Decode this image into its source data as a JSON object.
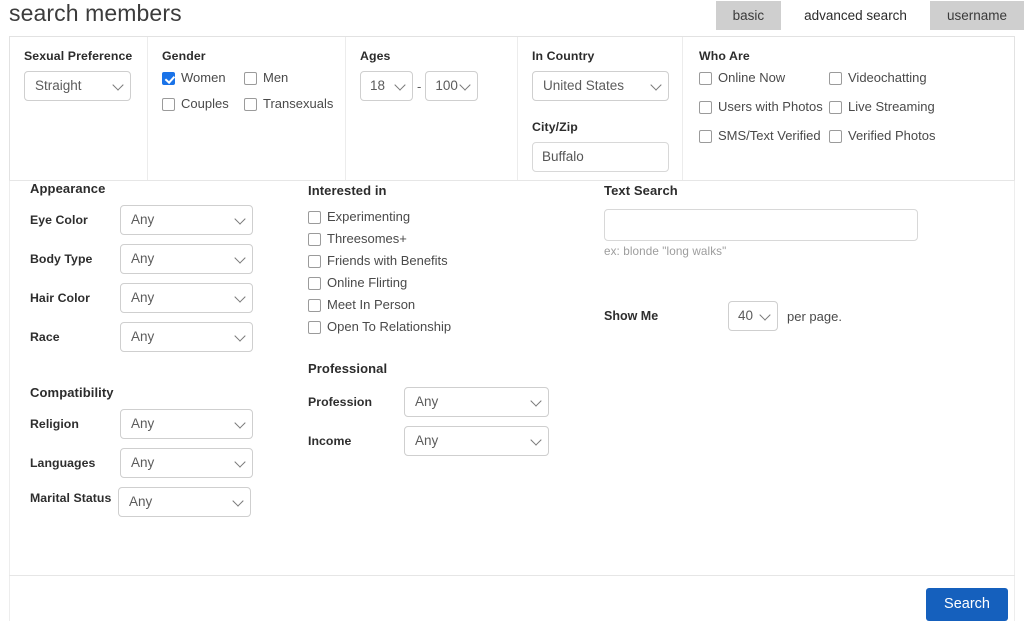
{
  "header": {
    "title": "search members",
    "tabs": [
      {
        "label": "basic",
        "active": false
      },
      {
        "label": "advanced search",
        "active": true
      },
      {
        "label": "username",
        "active": false
      }
    ]
  },
  "top_panel": {
    "sexual_preference": {
      "label": "Sexual Preference",
      "value": "Straight"
    },
    "gender": {
      "label": "Gender",
      "options": [
        {
          "label": "Women",
          "checked": true
        },
        {
          "label": "Men",
          "checked": false
        },
        {
          "label": "Couples",
          "checked": false
        },
        {
          "label": "Transexuals",
          "checked": false
        }
      ]
    },
    "ages": {
      "label": "Ages",
      "min": "18",
      "separator": "-",
      "max": "100"
    },
    "country": {
      "label": "In Country",
      "value": "United States"
    },
    "city_zip": {
      "label": "City/Zip",
      "value": "Buffalo"
    },
    "who_are": {
      "label": "Who Are",
      "options": [
        {
          "label": "Online Now",
          "checked": false
        },
        {
          "label": "Videochatting",
          "checked": false
        },
        {
          "label": "Users with Photos",
          "checked": false
        },
        {
          "label": "Live Streaming",
          "checked": false
        },
        {
          "label": "SMS/Text Verified",
          "checked": false
        },
        {
          "label": "Verified Photos",
          "checked": false
        }
      ]
    }
  },
  "appearance": {
    "title": "Appearance",
    "fields": [
      {
        "label": "Eye Color",
        "value": "Any"
      },
      {
        "label": "Body Type",
        "value": "Any"
      },
      {
        "label": "Hair Color",
        "value": "Any"
      },
      {
        "label": "Race",
        "value": "Any"
      }
    ]
  },
  "compatibility": {
    "title": "Compatibility",
    "fields": [
      {
        "label": "Religion",
        "value": "Any"
      },
      {
        "label": "Languages",
        "value": "Any"
      },
      {
        "label": "Marital Status",
        "value": "Any"
      }
    ]
  },
  "interested_in": {
    "title": "Interested in",
    "options": [
      {
        "label": "Experimenting",
        "checked": false
      },
      {
        "label": "Threesomes+",
        "checked": false
      },
      {
        "label": "Friends with Benefits",
        "checked": false
      },
      {
        "label": "Online Flirting",
        "checked": false
      },
      {
        "label": "Meet In Person",
        "checked": false
      },
      {
        "label": "Open To Relationship",
        "checked": false
      }
    ]
  },
  "professional": {
    "title": "Professional",
    "fields": [
      {
        "label": "Profession",
        "value": "Any"
      },
      {
        "label": "Income",
        "value": "Any"
      }
    ]
  },
  "text_search": {
    "title": "Text Search",
    "value": "",
    "placeholder": "",
    "hint": "ex: blonde \"long walks\""
  },
  "show_me": {
    "label": "Show Me",
    "value": "40",
    "suffix": "per page."
  },
  "footer": {
    "search_label": "Search"
  },
  "colors": {
    "accent": "#1a73e8",
    "button": "#1560bd",
    "tab_inactive": "#cfcfcf"
  }
}
